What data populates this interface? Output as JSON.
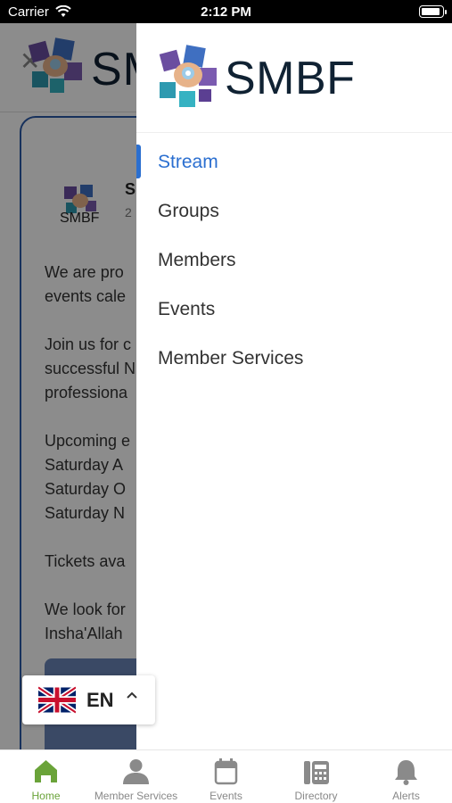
{
  "status_bar": {
    "carrier": "Carrier",
    "time": "2:12 PM"
  },
  "brand": {
    "logo_text": "SMBF",
    "accent_color": "#2b6fd0",
    "tab_active_color": "#6aa339"
  },
  "background_post": {
    "avatar_text": "SMBF",
    "author": "S",
    "date": "2",
    "body": "We are pro\nevents cale\n\nJoin us for c\nsuccessful N\nprofessiona\n\nUpcoming e\nSaturday A\nSaturday O\nSaturday N\n\nTickets ava\n\nWe look for\nInsha'Allah"
  },
  "drawer": {
    "menu": [
      {
        "label": "Stream",
        "active": true
      },
      {
        "label": "Groups",
        "active": false
      },
      {
        "label": "Members",
        "active": false
      },
      {
        "label": "Events",
        "active": false
      },
      {
        "label": "Member Services",
        "active": false
      }
    ]
  },
  "language": {
    "code": "EN",
    "flag_icon": "uk-flag-icon"
  },
  "tabs": [
    {
      "label": "Home",
      "icon": "home-icon",
      "active": true
    },
    {
      "label": "Member Services",
      "icon": "person-icon",
      "active": false
    },
    {
      "label": "Events",
      "icon": "calendar-icon",
      "active": false
    },
    {
      "label": "Directory",
      "icon": "directory-icon",
      "active": false
    },
    {
      "label": "Alerts",
      "icon": "bell-icon",
      "active": false
    }
  ]
}
